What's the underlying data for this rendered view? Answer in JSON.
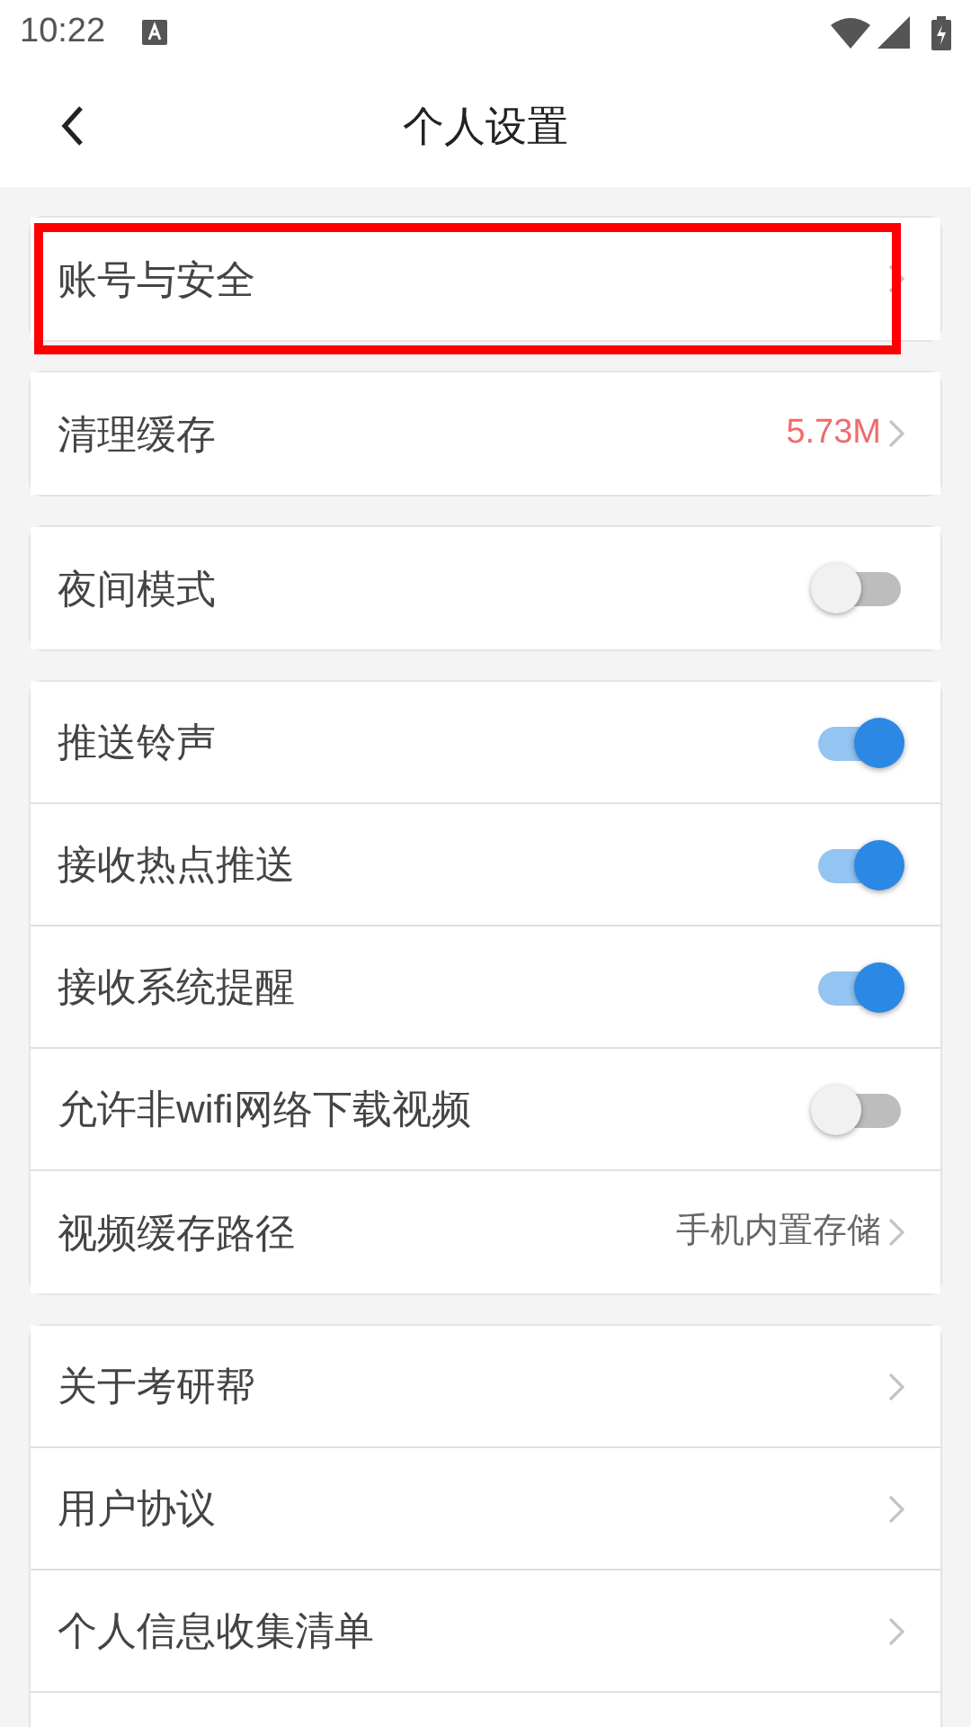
{
  "status_bar": {
    "time": "10:22"
  },
  "header": {
    "title": "个人设置"
  },
  "groups": [
    {
      "items": [
        {
          "kind": "link",
          "label": "账号与安全",
          "highlighted": true
        }
      ]
    },
    {
      "items": [
        {
          "kind": "link",
          "label": "清理缓存",
          "value": "5.73M",
          "color": "#f06b6b",
          "highlighted": false
        }
      ]
    },
    {
      "items": [
        {
          "kind": "toggle",
          "label": "夜间模式",
          "on": false
        }
      ]
    },
    {
      "items": [
        {
          "kind": "toggle",
          "label": "推送铃声",
          "on": true
        },
        {
          "kind": "toggle",
          "label": "接收热点推送",
          "on": true
        },
        {
          "kind": "toggle",
          "label": "接收系统提醒",
          "on": true
        },
        {
          "kind": "toggle",
          "label": "允许非wifi网络下载视频",
          "on": false
        },
        {
          "kind": "link",
          "label": "视频缓存路径",
          "value": "手机内置存储",
          "color": "#666666",
          "highlighted": false
        }
      ]
    },
    {
      "items": [
        {
          "kind": "link",
          "label": "关于考研帮",
          "highlighted": false
        },
        {
          "kind": "link",
          "label": "用户协议",
          "highlighted": false
        },
        {
          "kind": "link",
          "label": "个人信息收集清单",
          "highlighted": false
        },
        {
          "kind": "blank"
        }
      ]
    }
  ]
}
